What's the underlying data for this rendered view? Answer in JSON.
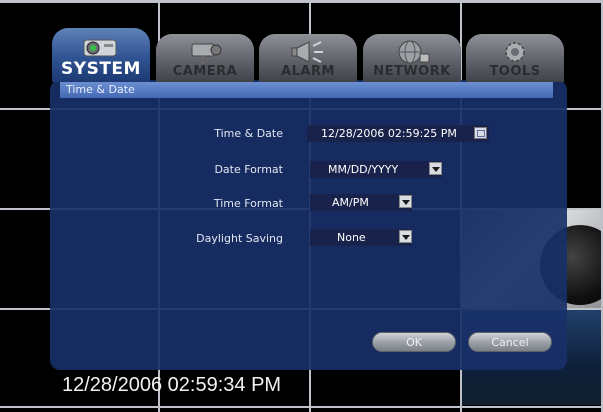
{
  "tabs": [
    {
      "label": "SYSTEM",
      "icon": "projector-icon",
      "active": true
    },
    {
      "label": "CAMERA",
      "icon": "camera-icon",
      "active": false
    },
    {
      "label": "ALARM",
      "icon": "alarm-horn-icon",
      "active": false
    },
    {
      "label": "NETWORK",
      "icon": "globe-network-icon",
      "active": false
    },
    {
      "label": "TOOLS",
      "icon": "gear-tools-icon",
      "active": false
    }
  ],
  "panel": {
    "title": "Time & Date"
  },
  "settings": {
    "time_date": {
      "label": "Time & Date",
      "value": "12/28/2006 02:59:25 PM"
    },
    "date_format": {
      "label": "Date Format",
      "value": "MM/DD/YYYY"
    },
    "time_format": {
      "label": "Time Format",
      "value": "AM/PM"
    },
    "daylight_saving": {
      "label": "Daylight Saving",
      "value": "None"
    }
  },
  "buttons": {
    "ok": "OK",
    "cancel": "Cancel"
  },
  "clock": "12/28/2006 02:59:34 PM",
  "colors": {
    "panel": "#183068",
    "active_tab": "#2f5392",
    "title_bar": "#4f74bd"
  }
}
